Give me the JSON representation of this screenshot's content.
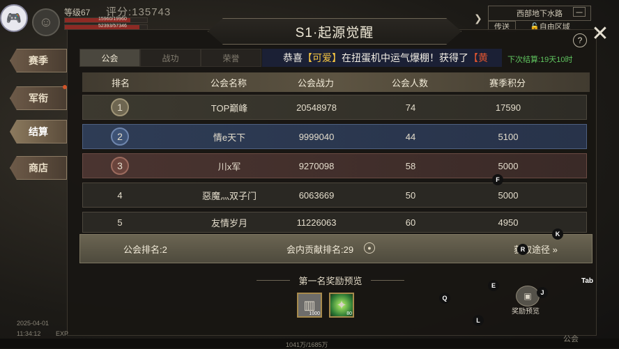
{
  "hud": {
    "level": "等级67",
    "score": "评分:135743",
    "hp_text": "15960/19960",
    "hp_fill": 0.8,
    "mp_text": "52393/57346",
    "mp_fill": 0.91,
    "location": "西部地下水路",
    "minimize": "一",
    "teleport": "传送",
    "free_area": "自由区域"
  },
  "side_tabs": [
    {
      "label": "赛季"
    },
    {
      "label": "军衔"
    },
    {
      "label": "结算"
    },
    {
      "label": "商店"
    }
  ],
  "panel": {
    "title": "S1·起源觉醒",
    "help": "?",
    "close": "✕",
    "tabs": [
      "公会",
      "战功",
      "荣誉"
    ],
    "marquee_prefix": "恭喜",
    "marquee_name": "【可爱】",
    "marquee_mid": "在扭蛋机中运气爆棚！获得了",
    "marquee_item": "【黄",
    "settle": "下次结算:19天10时"
  },
  "table": {
    "headers": [
      "排名",
      "公会名称",
      "公会战力",
      "公会人数",
      "赛季积分"
    ],
    "rows": [
      {
        "rank": "1",
        "name": "TOP巅峰",
        "power": "20548978",
        "members": "74",
        "points": "17590"
      },
      {
        "rank": "2",
        "name": "情e天下",
        "power": "9999040",
        "members": "44",
        "points": "5100"
      },
      {
        "rank": "3",
        "name": "川x军",
        "power": "9270098",
        "members": "58",
        "points": "5000"
      },
      {
        "rank": "4",
        "name": "惡魔灬双子门",
        "power": "6063669",
        "members": "50",
        "points": "5000"
      },
      {
        "rank": "5",
        "name": "友情岁月",
        "power": "11226063",
        "members": "60",
        "points": "4950"
      }
    ]
  },
  "footer": {
    "guild_rank": "公会排名:2",
    "contrib_rank": "会内贡献排名:29",
    "get_path": "获取途径"
  },
  "rewards": {
    "title": "第一名奖励预览",
    "items": [
      {
        "name": "bullet-item",
        "qty": "1000"
      },
      {
        "name": "green-gem-item",
        "qty": "80"
      }
    ],
    "preview_label": "奖励预览"
  },
  "keys": {
    "f": "F",
    "k": "K",
    "r": "R",
    "e": "E",
    "j": "J",
    "q": "Q",
    "l": "L",
    "tab": "Tab"
  },
  "bottom": {
    "date": "2025-04-01",
    "time": "11:34:12",
    "exp": "EXP",
    "guild_total": "1041万/1685万",
    "guild": "公会"
  }
}
